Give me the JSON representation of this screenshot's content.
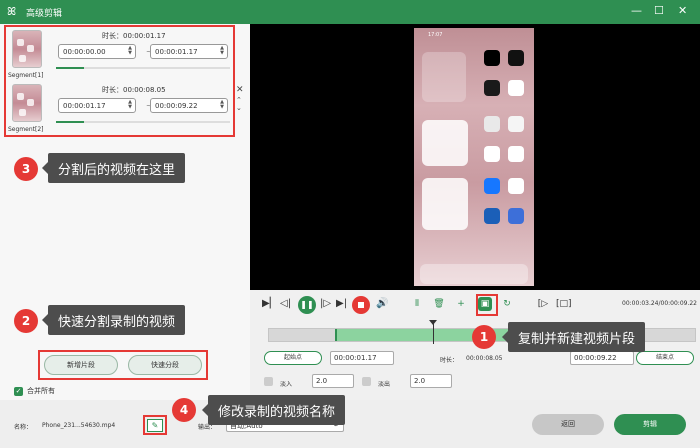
{
  "window": {
    "title": "高级剪辑",
    "app_icon": "rabbit-logo-icon"
  },
  "segments": [
    {
      "label": "Segment[1]",
      "duration_label": "时长：00:00:01.17",
      "start": "00:00:00.00",
      "end": "00:00:01.17"
    },
    {
      "label": "Segment[2]",
      "duration_label": "时长：00:00:08.05",
      "start": "00:00:01.17",
      "end": "00:00:09.22"
    }
  ],
  "buttons": {
    "new_clip": "新增片段",
    "quick_split": "快速分段",
    "back": "返回",
    "edit": "剪辑"
  },
  "merge_all": "合并所有",
  "callouts": {
    "c1": {
      "num": "1",
      "text": "复制并新建视频片段"
    },
    "c2": {
      "num": "2",
      "text": "快速分割录制的视频"
    },
    "c3": {
      "num": "3",
      "text": "分割后的视频在这里"
    },
    "c4": {
      "num": "4",
      "text": "修改录制的视频名称"
    }
  },
  "player": {
    "timecode": "00:00:03.24/00:00:09.22",
    "phone_clock": "17:07"
  },
  "trim": {
    "start_point": "起始点",
    "start_time": "00:00:01.17",
    "duration_label": "时长：",
    "duration_value": "00:00:08.05",
    "end_time": "00:00:09.22",
    "end_point": "结束点",
    "fade_in_label": "淡入",
    "fade_in_value": "2.0",
    "fade_out_label": "淡出",
    "fade_out_value": "2.0"
  },
  "bottom": {
    "name_label": "名称：",
    "file_name": "Phone_231...54630.mp4",
    "output_label": "输出：",
    "output_value": "自动;Auto"
  },
  "colors": {
    "accent": "#2f8f52",
    "highlight": "#e53935",
    "callout_bg": "#4d4d4d"
  }
}
